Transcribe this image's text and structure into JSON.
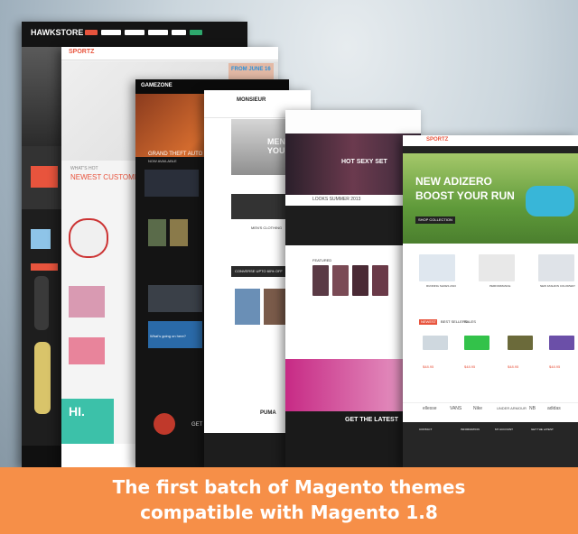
{
  "banner": {
    "line1": "The first batch of Magento themes",
    "line2": "compatible with Magento 1.8",
    "color": "#f68f48"
  },
  "hawkstore": {
    "logo": "HAWKSTORE",
    "whats_hot": "WHAT'S HOT",
    "newest": "NEWEST CUSTOMER",
    "hi": "HI.",
    "accent": "#e8543d"
  },
  "sportz": {
    "logo": "SPORTZ",
    "from_june": "FROM JUNE 16"
  },
  "gamezone": {
    "logo": "GAMEZONE",
    "gta": "GRAND THEFT AUTO V",
    "available": "NOW AVAILABLE",
    "whats_going": "What's going on here?",
    "get": "GET"
  },
  "monsieur": {
    "logo": "MONSIEUR",
    "men": "MEN",
    "your": "YOU",
    "clothing": "MEN'S CLOTHING",
    "converse": "CONVERSE UPTO 60% OFF",
    "puma": "PUMA"
  },
  "lingerie": {
    "hot": "HOT SEXY SET",
    "looks": "LOOKS SUMMER 2013",
    "featured": "FEATURED",
    "get_latest": "GET THE LATEST"
  },
  "sportz2": {
    "logo": "SPORTZ",
    "hero_title": "NEW ADIZERO",
    "hero_sub": "BOOST YOUR RUN",
    "cta": "SHOP COLLECTION",
    "tabs": [
      "NEWEST",
      "BEST SELLERS",
      "SALES"
    ],
    "categories": [
      "RUNNING SHOES 2013",
      "PERFORMANCE",
      "NEW FASHION COLORWAY"
    ],
    "brands": [
      "ellesse",
      "VANS",
      "Nike",
      "UNDER ARMOUR",
      "NB",
      "adidas"
    ],
    "footer_cols": [
      "CONTACT",
      "INFORMATION",
      "MY ACCOUNT",
      "GET THE LATEST"
    ],
    "prices": [
      "$48.95",
      "$48.95",
      "$48.95",
      "$48.95"
    ]
  }
}
